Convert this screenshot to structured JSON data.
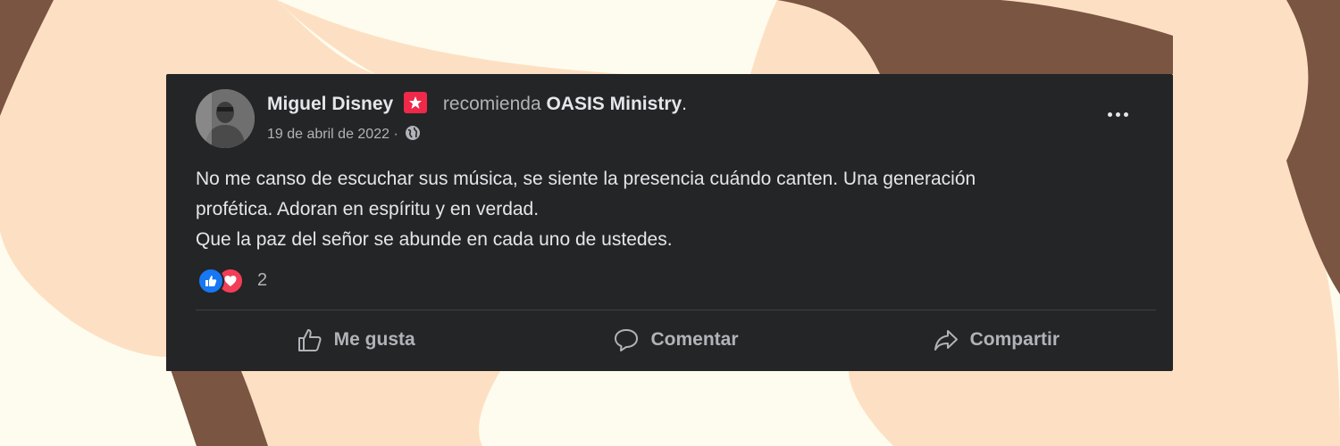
{
  "colors": {
    "background": "#fefcee",
    "blob_light": "#fde0c3",
    "blob_dark": "#7a5542",
    "card": "#242526",
    "text_primary": "#e4e6eb",
    "text_secondary": "#b0b3b8",
    "like_blue": "#1877f2",
    "love_red": "#f33e58"
  },
  "post": {
    "author": "Miguel Disney",
    "author_badge_icon": "recommendation-star-icon",
    "action_text": "recomienda",
    "page_name": "OASIS Ministry",
    "period": ".",
    "date": "19 de abril de 2022 ·",
    "privacy_icon": "globe-icon",
    "menu_icon": "more-options-icon",
    "body_lines": [
      "No me canso de escuchar sus música, se siente la presencia cuándo canten. Una generación",
      "profética. Adoran en espíritu y en verdad.",
      "Que la paz del señor se abunde en cada uno de ustedes."
    ],
    "reactions": {
      "icons": [
        "like-reaction-icon",
        "love-reaction-icon"
      ],
      "count": "2"
    }
  },
  "actions": {
    "like": {
      "label": "Me gusta",
      "icon": "thumbs-up-icon"
    },
    "comment": {
      "label": "Comentar",
      "icon": "comment-bubble-icon"
    },
    "share": {
      "label": "Compartir",
      "icon": "share-arrow-icon"
    }
  }
}
